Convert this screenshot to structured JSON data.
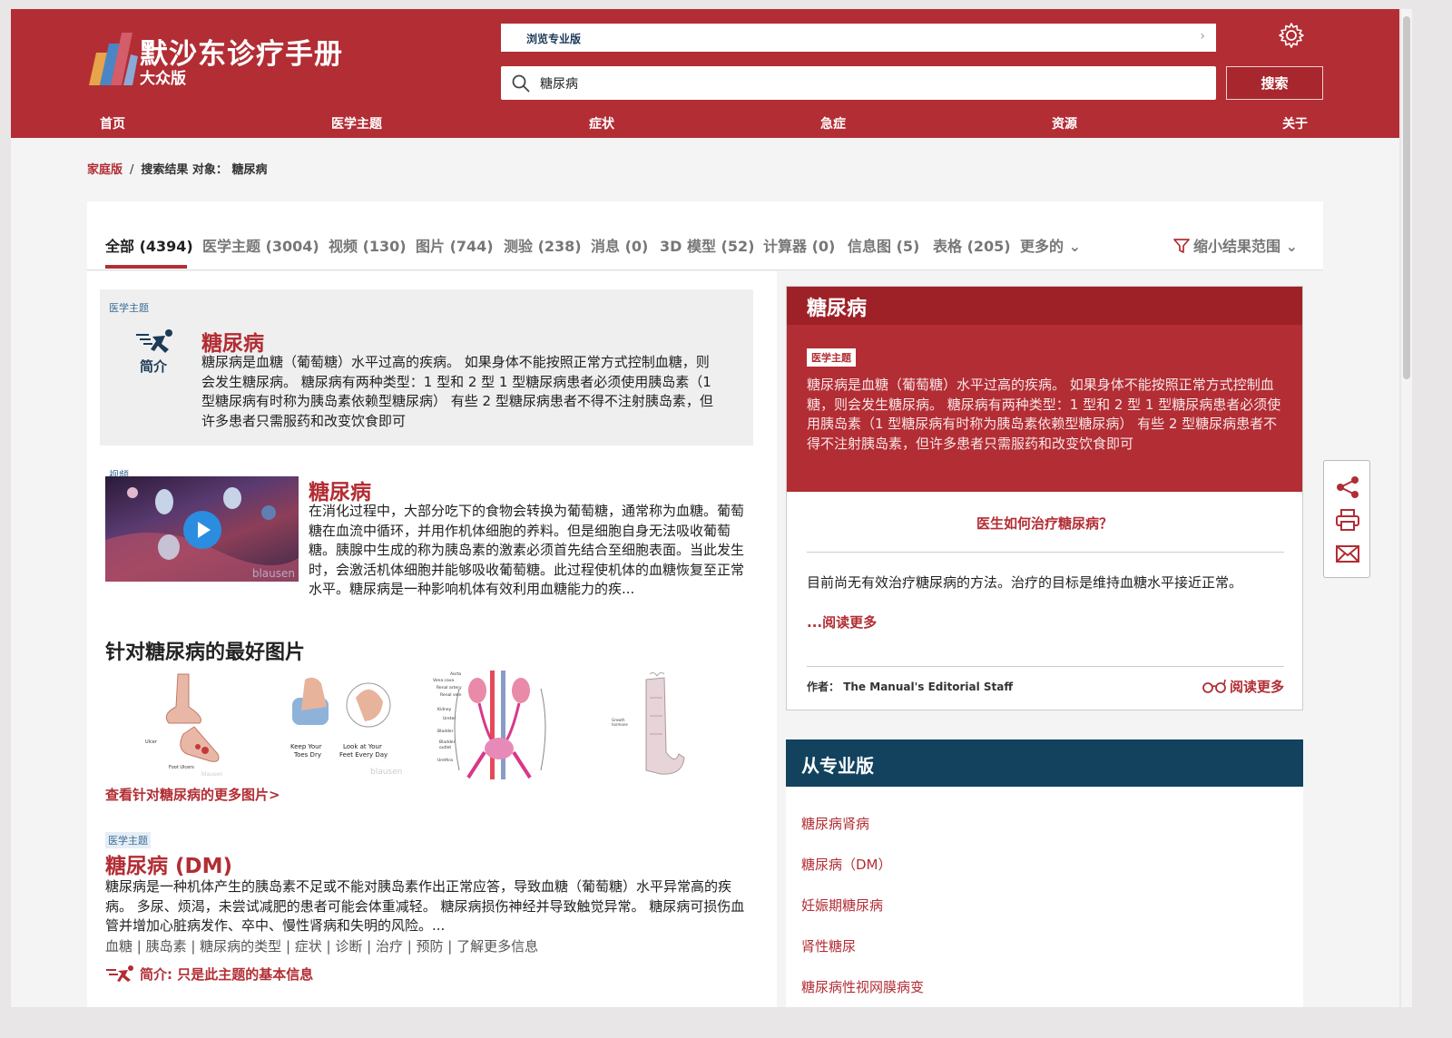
{
  "header": {
    "title": "默沙东诊疗手册",
    "subtitle": "大众版",
    "pro_link": "浏览专业版",
    "search_value": "糖尿病",
    "search_button": "搜索",
    "nav": [
      "首页",
      "医学主题",
      "症状",
      "急症",
      "资源",
      "关于"
    ]
  },
  "breadcrumb": {
    "home": "家庭版",
    "sep": "/",
    "current": "搜索结果 对象： 糖尿病"
  },
  "tabs": {
    "items": [
      "全部 (4394)",
      "医学主题 (3004)",
      "视频 (130)",
      "图片 (744)",
      "测验 (238)",
      "消息 (0)",
      "3D 模型 (52)",
      "计算器 (0)",
      "信息图 (5)",
      "表格 (205)",
      "更多的 ⌄"
    ],
    "narrow": "缩小结果范围 ⌄"
  },
  "results": {
    "r1": {
      "tag": "医学主题",
      "badge": "简介",
      "title": "糖尿病",
      "text": "糖尿病是血糖（葡萄糖）水平过高的疾病。 如果身体不能按照正常方式控制血糖，则会发生糖尿病。 糖尿病有两种类型：1 型和 2 型 1 型糖尿病患者必须使用胰岛素（1 型糖尿病有时称为胰岛素依赖型糖尿病） 有些 2 型糖尿病患者不得不注射胰岛素，但许多患者只需服药和改变饮食即可"
    },
    "r2": {
      "tag": "视频",
      "title": "糖尿病",
      "watermark": "blausen",
      "text": "在消化过程中，大部分吃下的食物会转换为葡萄糖，通常称为血糖。葡萄糖在血流中循环，并用作机体细胞的养料。但是细胞自身无法吸收葡萄糖。胰腺中生成的称为胰岛素的激素必须首先结合至细胞表面。当此发生时，会激活机体细胞并能够吸收葡萄糖。此过程使机体的血糖恢复至正常水平。糖尿病是一种影响机体有效利用血糖能力的疾..."
    },
    "images": {
      "heading": "针对糖尿病的最好图片",
      "img1_labels": [
        "Ulcer",
        "Foot Ulcers",
        "blausen"
      ],
      "img2_labels": [
        "Keep Your",
        "Toes Dry",
        "Look at Your",
        "Feet Every Day",
        "blausen"
      ],
      "img3_labels": [
        "Aorta",
        "Vena cava",
        "Renal artery",
        "Renal vein",
        "Kidney",
        "Ureter",
        "Bladder",
        "Bladder",
        "outlet",
        "Urethra"
      ],
      "img4_labels": [
        "Growth",
        "hormone"
      ],
      "more": "查看针对糖尿病的更多图片>"
    },
    "r3": {
      "tag": "医学主题",
      "title": "糖尿病 (DM)",
      "text": "糖尿病是一种机体产生的胰岛素不足或不能对胰岛素作出正常应答，导致血糖（葡萄糖）水平异常高的疾病。 多尿、烦渴，未尝试减肥的患者可能会体重减轻。 糖尿病损伤神经并导致触觉异常。 糖尿病可损伤血管并增加心脏病发作、卒中、慢性肾病和失明的风险。...",
      "links": "血糖 | 胰岛素 | 糖尿病的类型 | 症状 | 诊断 | 治疗 | 预防 | 了解更多信息",
      "basic": "简介: 只是此主题的基本信息"
    }
  },
  "side": {
    "title": "糖尿病",
    "tag": "医学主题",
    "text": "糖尿病是血糖（葡萄糖）水平过高的疾病。 如果身体不能按照正常方式控制血糖，则会发生糖尿病。 糖尿病有两种类型：1 型和 2 型 1 型糖尿病患者必须使用胰岛素（1 型糖尿病有时称为胰岛素依赖型糖尿病） 有些 2 型糖尿病患者不得不注射胰岛素，但许多患者只需服药和改变饮食即可",
    "question": "医生如何治疗糖尿病？",
    "answer": "目前尚无有效治疗糖尿病的方法。治疗的目标是维持血糖水平接近正常。",
    "more": "...阅读更多",
    "author_label": "作者：",
    "author": "The Manual's Editorial Staff",
    "read_more": "阅读更多"
  },
  "pro": {
    "title": "从专业版",
    "links": [
      "糖尿病肾病",
      "糖尿病（DM）",
      "妊娠期糖尿病",
      "肾性糖尿",
      "糖尿病性视网膜病变"
    ]
  },
  "colors": {
    "brand_red": "#b22d34",
    "pro_navy": "#12425e"
  }
}
